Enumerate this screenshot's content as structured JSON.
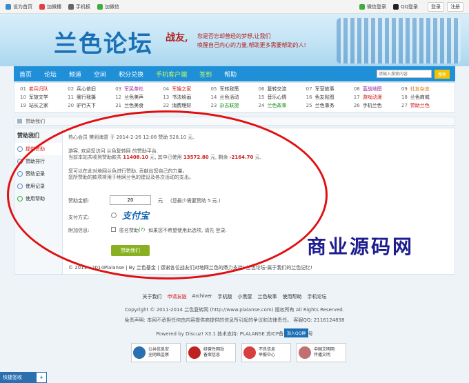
{
  "topbar": {
    "left": [
      "设为首页",
      "加微播",
      "手机板",
      "加微信"
    ],
    "right": [
      "微信登录",
      "QQ登录",
      "登录",
      "注册"
    ]
  },
  "banner": {
    "logo": "兰色论坛",
    "slogan_title": "战友,",
    "slogan_line1": "您是否忘却曾经的梦想,让我们",
    "slogan_line2": "唤醒自己内心的力量,帮助更多需要帮助的人!"
  },
  "nav": {
    "items": [
      "首页",
      "论坛",
      "频道",
      "空间",
      "积分兑换",
      "手机客户端",
      "签到",
      "帮助"
    ],
    "search_placeholder": "请输入搜索内容",
    "search_button": "搜索"
  },
  "links": {
    "row1": [
      {
        "n": "01",
        "t": "老兵归队"
      },
      {
        "n": "02",
        "t": "兵心依旧"
      },
      {
        "n": "03",
        "t": "军民茶社"
      },
      {
        "n": "04",
        "t": "军嫂之家"
      },
      {
        "n": "05",
        "t": "军转政策"
      },
      {
        "n": "06",
        "t": "复转交流"
      },
      {
        "n": "07",
        "t": "军营故事"
      },
      {
        "n": "08",
        "t": "蓝战地图"
      },
      {
        "n": "09",
        "t": "社友杂志"
      }
    ],
    "row2": [
      {
        "n": "10",
        "t": "军旅文学"
      },
      {
        "n": "11",
        "t": "我行我摄"
      },
      {
        "n": "12",
        "t": "兰色美声"
      },
      {
        "n": "13",
        "t": "书法绘画"
      },
      {
        "n": "14",
        "t": "兰色活动"
      },
      {
        "n": "15",
        "t": "音乐心情"
      },
      {
        "n": "16",
        "t": "色友贴图"
      },
      {
        "n": "17",
        "t": "游戏动漫"
      },
      {
        "n": "18",
        "t": "兰色商城"
      }
    ],
    "row3": [
      {
        "n": "19",
        "t": "站长之家"
      },
      {
        "n": "20",
        "t": "驴行天下"
      },
      {
        "n": "21",
        "t": "兰色美食"
      },
      {
        "n": "22",
        "t": "消费理财"
      },
      {
        "n": "23",
        "t": "杂志联盟"
      },
      {
        "n": "24",
        "t": "兰色故事"
      },
      {
        "n": "25",
        "t": "兰色事务"
      },
      {
        "n": "26",
        "t": "手机兰色"
      },
      {
        "n": "27",
        "t": "赞助兰色"
      }
    ]
  },
  "breadcrumb": "赞助我们",
  "sidebar": {
    "title": "赞助我们",
    "items": [
      "提供赞助",
      "赞助排行",
      "赞助记录",
      "使用记录",
      "使用帮助"
    ]
  },
  "content": {
    "notice": "热心会员 樊则海意 于 2014-2-26 12:08 赞助 528.10 元.",
    "greet": "游客, 欢迎您访问 兰色复转网 的赞助平台.",
    "stats_prefix": "当前本站共收到赞助款共",
    "total": "11408.10",
    "stats_mid1": "元, 其中已使用",
    "used": "13572.80",
    "stats_mid2": "元, 剩余",
    "left": "-2164.70",
    "stats_suffix": "元.",
    "para1": "您可以在此对地网兰色进行赞助, 贡献出您自己的力量。",
    "para2": "您所赞助的款项将用于地网兰色的建设及各次活动的支出。",
    "amount_label": "赞助金额:",
    "amount_value": "20",
    "amount_unit": "元",
    "amount_hint": "(您最少需要赞助 5 元.)",
    "pay_label": "支付方式:",
    "pay_method": "支付宝",
    "extra_label": "附加信息:",
    "anon_label": "匿名赞助",
    "anon_help": "(?)",
    "extra_hint": "如果您不希望使用此选项, 请先 登录.",
    "submit": "赞助我们",
    "copyright": "© 2011 - 2014Plalanse | By 兰色基金 | 感谢各位战友们对地网兰色的鼎力支持! 兰色论坛-属于我们的兰色记忆!"
  },
  "watermark": "商业源码网",
  "footer": {
    "links": [
      "关于我们",
      "申请友链",
      "Archiver",
      "手机版",
      "小黑屋",
      "兰色故事",
      "使用帮助",
      "手机论坛"
    ],
    "line1": "Copyright © 2011-2014 兰色复转网 (http://www.plalanse.com) 版权所有 All Rights Reserved.",
    "line2": "免责声明: 本网不承担任何由内容提供商提供的信息所引起的争议和法律责任。 客服QQ: 2116124838",
    "line3": "Powered by Discuz! X3.1 技术支持: PLALANSE 苏ICP备14005009号",
    "qq": "加入QQ群"
  },
  "badges": [
    {
      "l1": "公共信息安",
      "l2": "全网络监察"
    },
    {
      "l1": "经营性网站",
      "l2": "备案信息"
    },
    {
      "l1": "不良信息",
      "l2": "举报中心"
    },
    {
      "l1": "中国文明网",
      "l2": "传播文明"
    }
  ],
  "share": "快捷签收"
}
